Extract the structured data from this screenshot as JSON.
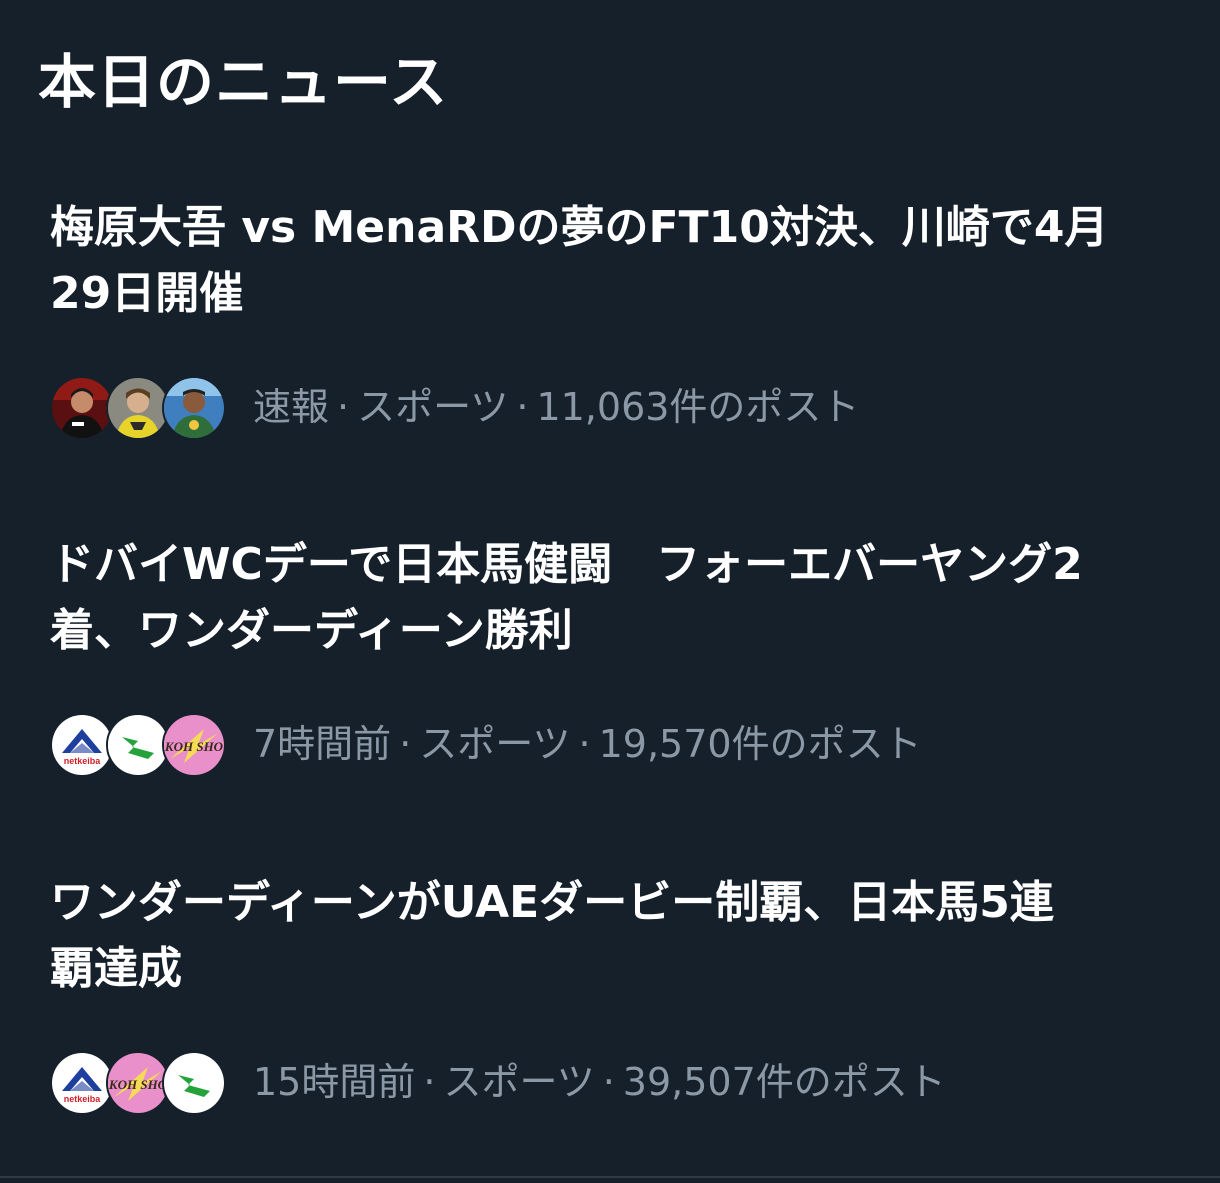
{
  "section": {
    "title": "本日のニュース"
  },
  "news": [
    {
      "headline_line1": "梅原大吾 vs MenaRDの夢のFT10対決、川崎で4月",
      "headline_line2": "29日開催",
      "time": "速報",
      "category": "スポーツ",
      "posts": "11,063件のポスト",
      "avatars": [
        "person-red-avatar",
        "person-yellow-avatar",
        "person-blue-avatar"
      ]
    },
    {
      "headline_line1": "ドバイWCデーで日本馬健闘　フォーエバーヤング2",
      "headline_line2": "着、ワンダーディーン勝利",
      "time": "7時間前",
      "category": "スポーツ",
      "posts": "19,570件のポスト",
      "avatars": [
        "netkeiba-logo",
        "green-horse-logo",
        "koh-sho-logo"
      ]
    },
    {
      "headline_line1": "ワンダーディーンがUAEダービー制覇、日本馬5連",
      "headline_line2": "覇達成",
      "time": "15時間前",
      "category": "スポーツ",
      "posts": "39,507件のポスト",
      "avatars": [
        "netkeiba-logo",
        "koh-sho-logo",
        "green-horse-logo"
      ]
    }
  ],
  "logos": {
    "netkeiba": "netkeiba",
    "kohsho": "KOH SHO"
  },
  "separator": "·",
  "colors": {
    "background": "#15202b",
    "headline": "#ffffff",
    "meta": "#8b98a5",
    "netkeiba_blue": "#1f3f9e",
    "netkeiba_red": "#d0202a",
    "green_logo": "#23a33a",
    "kohsho_pink": "#e98fc9"
  }
}
